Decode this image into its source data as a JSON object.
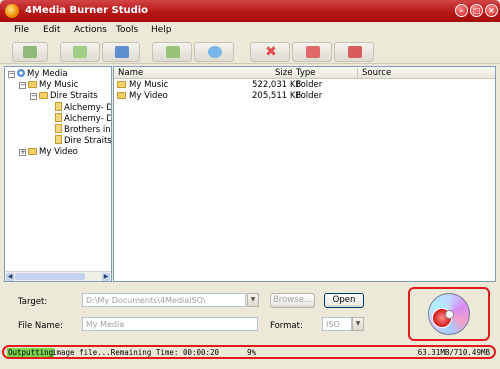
{
  "window": {
    "title": "4Media Burner Studio"
  },
  "menu": [
    "File",
    "Edit",
    "Actions",
    "Tools",
    "Help"
  ],
  "toolbar": {
    "buttons": [
      {
        "name": "new-project-icon",
        "color": "#8fb87a"
      },
      {
        "name": "add-files-icon",
        "color": "#9fcf84"
      },
      {
        "name": "add-folder-icon",
        "color": "#5f8fd0"
      },
      {
        "name": "open-folder-icon",
        "color": "#97c47a"
      },
      {
        "name": "add-disc-icon",
        "color": "#7ab6e8"
      },
      {
        "name": "delete-icon",
        "color": "#e05050"
      },
      {
        "name": "clear-icon",
        "color": "#e06a6a"
      },
      {
        "name": "remove-all-icon",
        "color": "#d85c5c"
      }
    ]
  },
  "tree": {
    "root": "My Media",
    "my_music": "My Music",
    "dire_straits": "Dire Straits",
    "files": [
      "Alchemy- Dire S",
      "Alchemy- Dire S",
      "Brothers in arm",
      "Dire Straits"
    ],
    "my_video": "My Video"
  },
  "list": {
    "headers": {
      "name": "Name",
      "size": "Size",
      "type": "Type",
      "source": "Source"
    },
    "rows": [
      {
        "name": "My Music",
        "size": "522,031 KB",
        "type": "Folder",
        "source": ""
      },
      {
        "name": "My Video",
        "size": "205,511 KB",
        "type": "Folder",
        "source": ""
      }
    ]
  },
  "target": {
    "label": "Target:",
    "value": "D:\\My Documents\\4MediaISO\\",
    "browse_label": "Browse...",
    "open_label": "Open"
  },
  "filename": {
    "label": "File Name:",
    "value": "My Media",
    "format_label": "Format:",
    "format_value": "ISO"
  },
  "status": {
    "highlight": "Outputting",
    "text": "image file...Remaining Time: 00:00:20",
    "percent": "9%",
    "size": "63.31MB/710.49MB"
  },
  "colors": {
    "title_bar": "#b81818",
    "highlight_box": "#e21c1c",
    "progress_highlight": "#7ad14a"
  }
}
